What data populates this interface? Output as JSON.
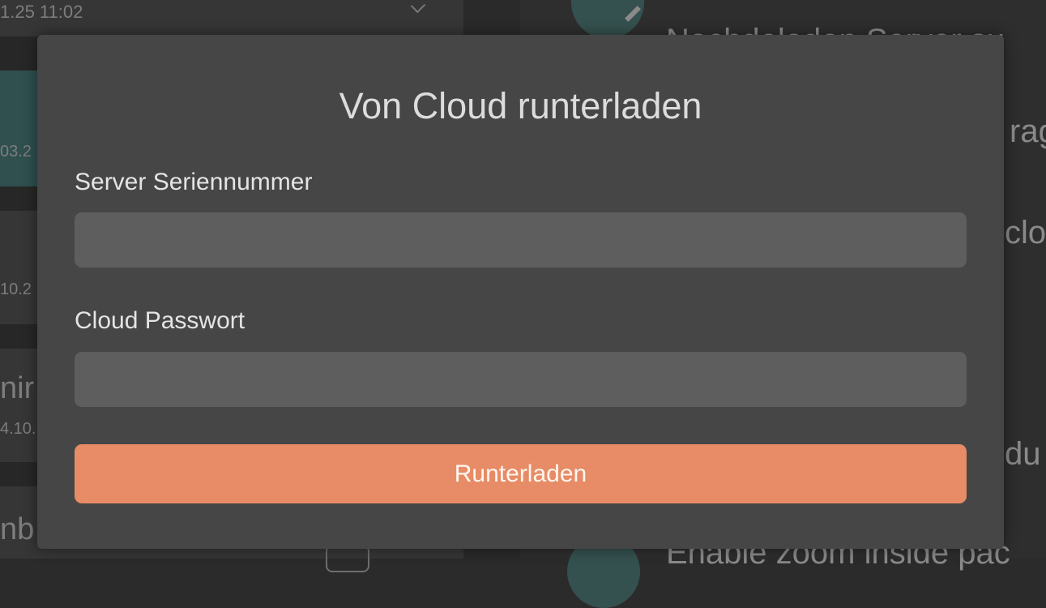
{
  "background": {
    "left_list": {
      "top_timestamp": "1.25 11:02",
      "row_dates": [
        "03.2",
        "10.2",
        "4.10."
      ],
      "row_fragments": [
        "nir",
        "nb"
      ]
    },
    "right_settings": {
      "fragments": [
        "Nachdeladen Server su",
        "rag",
        "clo",
        "du",
        "Enable zoom inside pac"
      ]
    }
  },
  "dialog": {
    "title": "Von Cloud runterladen",
    "serial_label": "Server Seriennummer",
    "serial_value": "",
    "serial_placeholder": "",
    "password_label": "Cloud Passwort",
    "password_value": "",
    "password_placeholder": "",
    "submit_label": "Runterladen"
  },
  "colors": {
    "accent": "#e78c66",
    "dialog_bg": "#464646",
    "input_bg": "#5e5e5e"
  }
}
